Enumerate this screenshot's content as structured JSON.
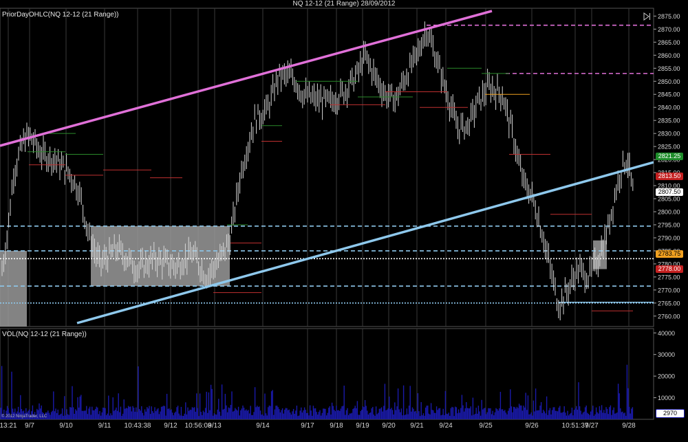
{
  "title": "NQ 12-12 (21 Range)  28/09/2012",
  "price_pane": {
    "label": "PriorDayOHLC(NQ 12-12 (21 Range))",
    "y_ticks": [
      "2875.00",
      "2870.00",
      "2865.00",
      "2860.00",
      "2855.00",
      "2850.00",
      "2845.00",
      "2840.00",
      "2835.00",
      "2830.00",
      "2825.00",
      "2820.00",
      "2815.00",
      "2810.00",
      "2805.00",
      "2800.00",
      "2795.00",
      "2790.00",
      "2785.00",
      "2780.00",
      "2775.00",
      "2770.00",
      "2765.00",
      "2760.00"
    ],
    "price_tags": [
      {
        "value": "2821.25",
        "price": 2821.25,
        "bg": "#1e8c2a",
        "fg": "#ffffff"
      },
      {
        "value": "2813.50",
        "price": 2813.5,
        "bg": "#c42020",
        "fg": "#ffffff"
      },
      {
        "value": "2807.50",
        "price": 2807.5,
        "bg": "#ffffff",
        "fg": "#000000"
      },
      {
        "value": "2783.75",
        "price": 2783.75,
        "bg": "#f0a020",
        "fg": "#000000"
      },
      {
        "value": "2778.00",
        "price": 2778.0,
        "bg": "#c42020",
        "fg": "#ffffff"
      }
    ],
    "channel_upper_color": "#e070d8",
    "channel_lower_color": "#8ec8ec",
    "level_lines": [
      {
        "price": 2871.5,
        "color": "#e070d8",
        "style": "dashed"
      },
      {
        "price": 2853.0,
        "color": "#e070d8",
        "style": "dashed"
      },
      {
        "price": 2794.5,
        "color": "#8ec8ec",
        "style": "dashed"
      },
      {
        "price": 2785.0,
        "color": "#8ec8ec",
        "style": "dashed"
      },
      {
        "price": 2782.0,
        "color": "#ffffff",
        "style": "dotted"
      },
      {
        "price": 2771.5,
        "color": "#8ec8ec",
        "style": "dashed"
      },
      {
        "price": 2765.0,
        "color": "#8ec8ec",
        "style": "dotted"
      }
    ]
  },
  "volume_pane": {
    "label": "VOL(NQ 12-12 (21 Range))",
    "y_ticks": [
      "40000",
      "30000",
      "20000",
      "10000"
    ],
    "last_value": "2970",
    "bar_color": "#1a1aaa"
  },
  "x_axis": {
    "labels": [
      "13:21",
      "9/7",
      "9/10",
      "9/11",
      "10:43:38",
      "9/12",
      "10:56:08",
      "9/13",
      "9/14",
      "9/17",
      "9/18",
      "9/19",
      "9/20",
      "9/21",
      "9/24",
      "9/25",
      "9/26",
      "10:51:37",
      "9/27",
      "9/28"
    ]
  },
  "copyright": "© 2012 NinjaTrader, LLC",
  "chart_data": {
    "type": "line",
    "title": "NQ 12-12 (21 Range)  28/09/2012",
    "xlabel": "",
    "ylabel": "",
    "ylim": [
      2756,
      2878
    ],
    "grid": true,
    "x": [
      "13:21",
      "9/7",
      "9/10",
      "9/11",
      "10:43:38",
      "9/12",
      "10:56:08",
      "9/13",
      "9/14",
      "9/17",
      "9/18",
      "9/19",
      "9/20",
      "9/21",
      "9/24",
      "9/25",
      "9/26",
      "10:51:37",
      "9/27",
      "9/28"
    ],
    "series": [
      {
        "name": "",
        "values": [
          2775,
          2829,
          2820,
          2787,
          2780,
          2778,
          2782,
          2775,
          2851,
          2844,
          2842,
          2852,
          2854,
          2860,
          2849,
          2843,
          2800,
          2763,
          2778,
          2813
        ]
      }
    ],
    "volume": {
      "ylim": [
        0,
        42000
      ],
      "last": 2970
    }
  }
}
